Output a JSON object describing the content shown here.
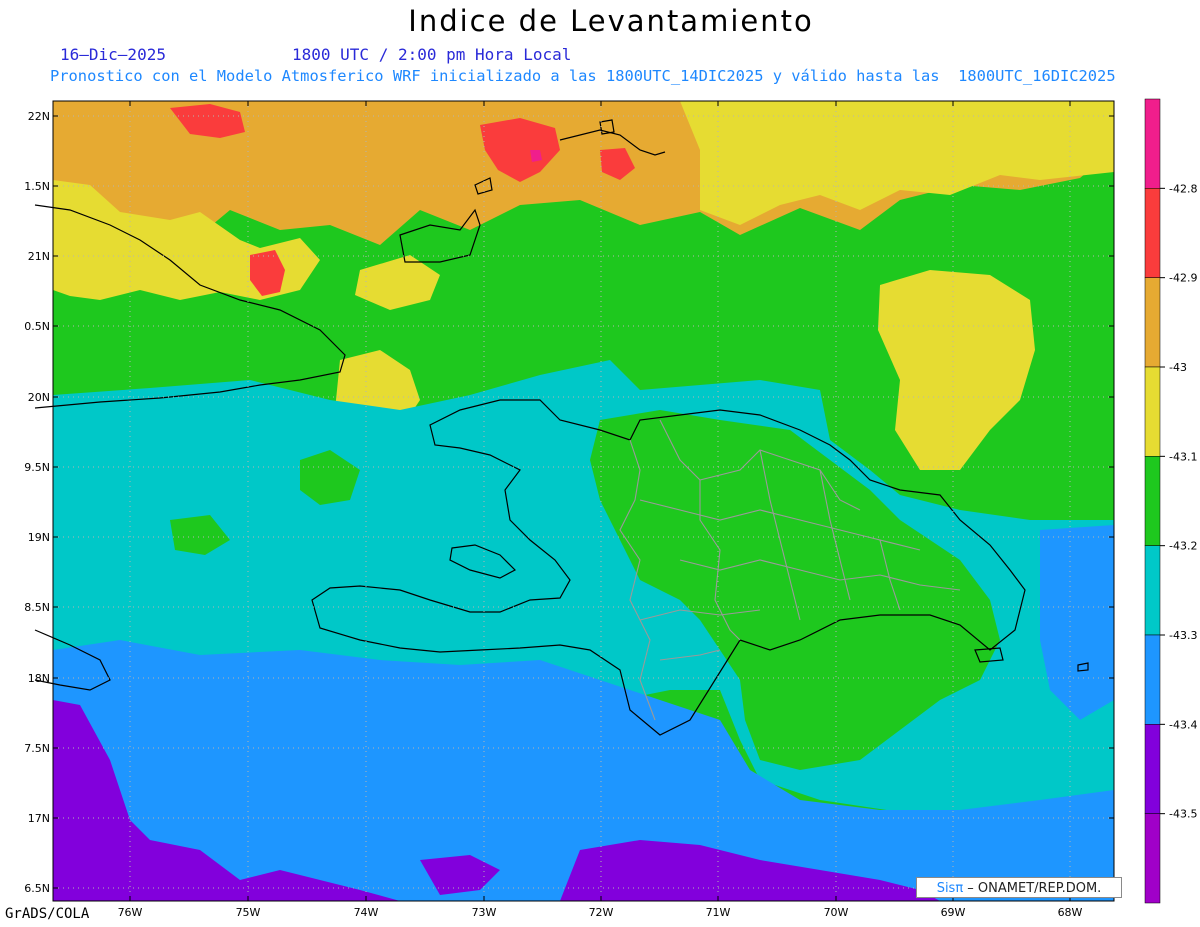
{
  "header": {
    "title": "Indice de Levantamiento",
    "date": "16–Dic–2025",
    "time": "1800 UTC / 2:00 pm Hora Local",
    "description": "Pronostico con el Modelo Atmosferico WRF inicializado a las 1800UTC_14DIC2025 y válido hasta las  1800UTC_16DIC2025"
  },
  "map": {
    "lat_ticks": [
      "22N",
      "21.5N",
      "21N",
      "20.5N",
      "20N",
      "19.5N",
      "19N",
      "18.5N",
      "18N",
      "17.5N",
      "17N",
      "16.5N"
    ],
    "lat_ticks_shown": [
      "22N",
      "1.5N",
      "21N",
      "0.5N",
      "20N",
      "9.5N",
      "19N",
      "8.5N",
      "18N",
      "7.5N",
      "17N",
      "6.5N"
    ],
    "lon_ticks": [
      "76W",
      "75W",
      "74W",
      "73W",
      "72W",
      "71W",
      "70W",
      "69W",
      "68W"
    ],
    "lat_range": [
      16.5,
      22.1
    ],
    "lon_range": [
      -76.6,
      -67.6
    ],
    "field": "Indice de Levantamiento"
  },
  "legend": {
    "labels": [
      "-42.8",
      "-42.9",
      "-43",
      "-43.1",
      "-43.2",
      "-43.3",
      "-43.4",
      "-43.5"
    ],
    "colors": [
      "#f01e8c",
      "#fa3c3c",
      "#e6aa32",
      "#e6dc32",
      "#1ec81e",
      "#00c8c8",
      "#1e96ff",
      "#8200dc",
      "#a000c8"
    ]
  },
  "footer": {
    "credit": "GrADS/COLA",
    "logo_sis": "Sisπ",
    "logo_org": " – ONAMET/REP.DOM."
  }
}
